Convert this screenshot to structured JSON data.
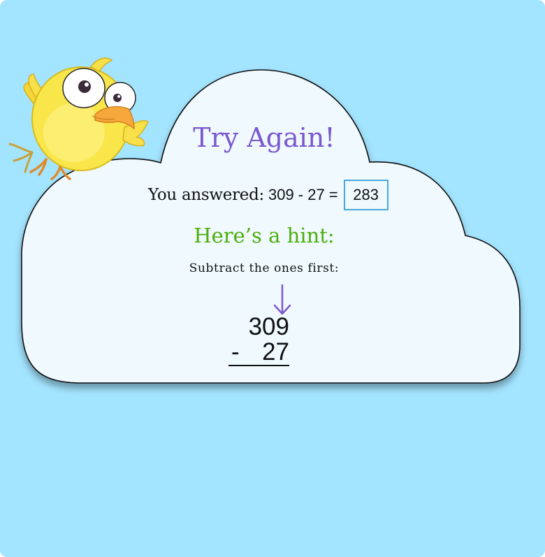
{
  "feedback": {
    "title": "Try Again!",
    "answer_label": "You answered:",
    "answer_expression": "309 - 27 =",
    "answer_value": "283",
    "hint_title": "Here’s a hint:",
    "hint_text": "Subtract the ones first:",
    "problem": {
      "top_number": "309",
      "operator": "-",
      "bottom_number": "27"
    }
  },
  "mascot": {
    "icon": "yellow-bird-icon"
  },
  "icons": {
    "hint_arrow": "down-arrow-icon"
  },
  "colors": {
    "background": "#a3e4ff",
    "cloud_fill": "#eff9fe",
    "title": "#7b58cf",
    "hint_title": "#4cae09",
    "answer_box_border": "#4aa8da",
    "arrow": "#7b58cf"
  }
}
